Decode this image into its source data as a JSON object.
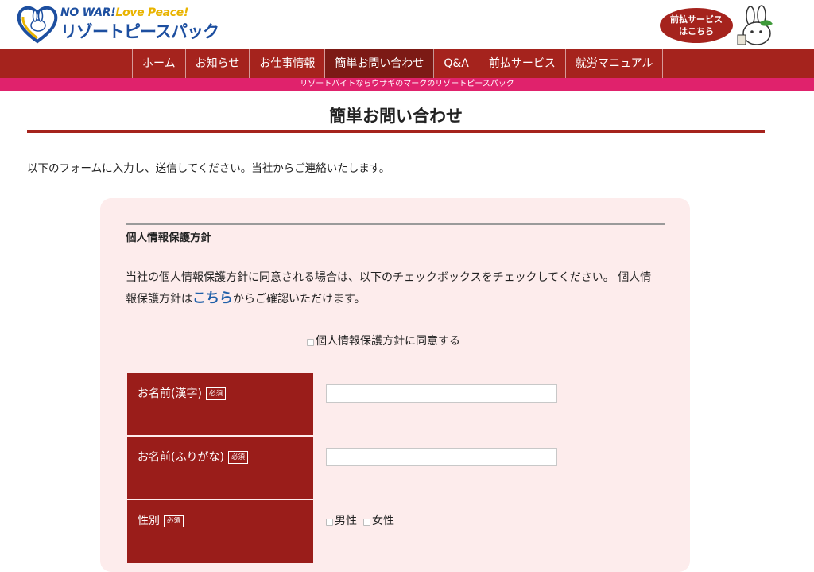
{
  "header": {
    "logo_top_a": "NO WAR!",
    "logo_top_b": "Love Peace!",
    "logo_main": "リゾートピースパック",
    "promo_line1": "前払サービス",
    "promo_line2": "はこちら"
  },
  "nav": {
    "items": [
      {
        "label": "ホーム",
        "active": false
      },
      {
        "label": "お知らせ",
        "active": false
      },
      {
        "label": "お仕事情報",
        "active": false
      },
      {
        "label": "簡単お問い合わせ",
        "active": true
      },
      {
        "label": "Q&A",
        "active": false
      },
      {
        "label": "前払サービス",
        "active": false
      },
      {
        "label": "就労マニュアル",
        "active": false
      }
    ],
    "tagline": "リゾートバイトならウサギのマークのリゾートピースパック"
  },
  "page": {
    "title": "簡単お問い合わせ",
    "intro": "以下のフォームに入力し、送信してください。当社からご連絡いたします。"
  },
  "policy": {
    "heading": "個人情報保護方針",
    "text_before": "当社の個人情報保護方針に同意される場合は、以下のチェックボックスをチェックしてください。 個人情報保護方針は",
    "link": "こちら",
    "text_after": "からご確認いただけます。",
    "agree_label": "個人情報保護方針に同意する"
  },
  "form": {
    "required_badge": "必須",
    "name_kanji_label": "お名前(漢字)",
    "name_kanji_value": "",
    "name_kana_label": "お名前(ふりがな)",
    "name_kana_value": "",
    "gender_label": "性別",
    "gender_options": [
      "男性",
      "女性"
    ]
  },
  "colors": {
    "brand_red": "#a5231d",
    "tagline_pink": "#e0226c",
    "card_bg": "#fdecec",
    "link_blue": "#1f5fa8"
  }
}
